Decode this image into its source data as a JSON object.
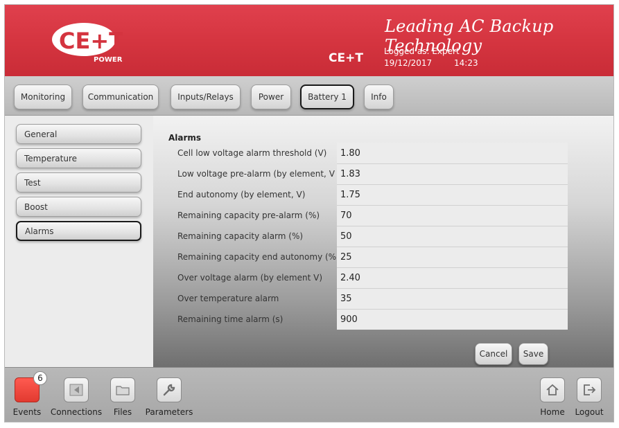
{
  "header": {
    "tagline": "Leading AC Backup Technology",
    "brand": "CE+T",
    "user_label": "Logged as: Expert",
    "date": "19/12/2017",
    "time": "14:23",
    "logo_text": "CE+T",
    "logo_subtext": "POWER",
    "colors": {
      "header_red": "#d4343f"
    }
  },
  "tabs": [
    {
      "label": "Monitoring"
    },
    {
      "label": "Communication"
    },
    {
      "label": "Inputs/Relays"
    },
    {
      "label": "Power"
    },
    {
      "label": "Battery 1",
      "active": true
    },
    {
      "label": "Info"
    }
  ],
  "sidebar": {
    "items": [
      {
        "label": "General"
      },
      {
        "label": "Temperature"
      },
      {
        "label": "Test"
      },
      {
        "label": "Boost"
      },
      {
        "label": "Alarms",
        "active": true
      }
    ]
  },
  "main": {
    "section_title": "Alarms",
    "fields": [
      {
        "label": "Cell low voltage alarm threshold (V)",
        "value": "1.80"
      },
      {
        "label": "Low voltage pre-alarm (by element, V",
        "value": "1.83"
      },
      {
        "label": "End autonomy (by element, V)",
        "value": "1.75"
      },
      {
        "label": "Remaining capacity pre-alarm (%)",
        "value": "70"
      },
      {
        "label": "Remaining capacity alarm (%)",
        "value": "50"
      },
      {
        "label": "Remaining capacity end autonomy (%",
        "value": "25"
      },
      {
        "label": "Over voltage alarm (by element V)",
        "value": "2.40"
      },
      {
        "label": "Over temperature alarm",
        "value": "35"
      },
      {
        "label": "Remaining time alarm (s)",
        "value": "900"
      }
    ],
    "cancel_label": "Cancel",
    "save_label": "Save"
  },
  "footer": {
    "events": {
      "label": "Events",
      "badge": "6",
      "icon": "alert-square-icon",
      "color": "#e23a30"
    },
    "connections": {
      "label": "Connections",
      "icon": "connections-icon"
    },
    "files": {
      "label": "Files",
      "icon": "folder-icon"
    },
    "parameters": {
      "label": "Parameters",
      "icon": "wrench-icon"
    },
    "home": {
      "label": "Home",
      "icon": "home-icon"
    },
    "logout": {
      "label": "Logout",
      "icon": "logout-icon"
    }
  }
}
